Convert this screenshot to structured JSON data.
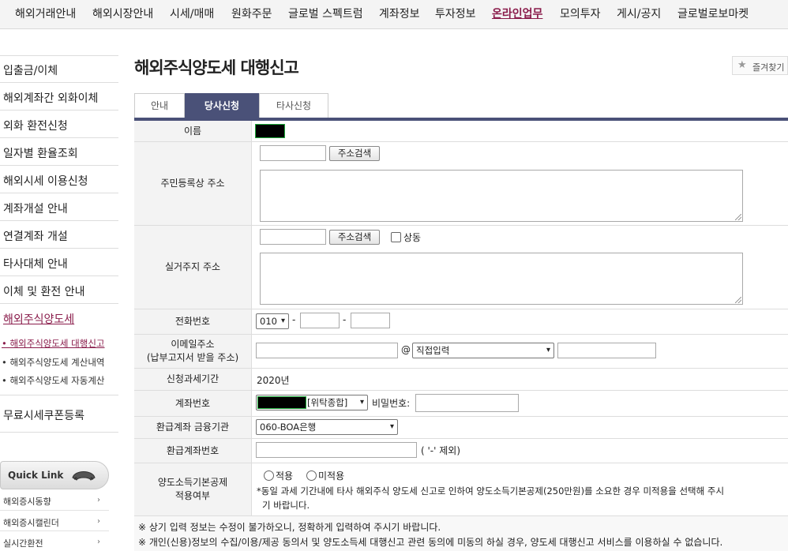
{
  "topnav": {
    "items": [
      "해외거래안내",
      "해외시장안내",
      "시세/매매",
      "원화주문",
      "글로벌 스펙트럼",
      "계좌정보",
      "투자정보",
      "온라인업무",
      "모의투자",
      "게시/공지",
      "글로벌로보마켓"
    ]
  },
  "sidebar": {
    "items": [
      "입출금/이체",
      "해외계좌간 외화이체",
      "외화 환전신청",
      "일자별 환율조회",
      "해외시세 이용신청",
      "계좌개설 안내",
      "연결계좌 개설",
      "타사대체 안내",
      "이체 및 환전 안내",
      "해외주식양도세"
    ],
    "subitems": [
      "해외주식양도세 대행신고",
      "해외주식양도세 계산내역",
      "해외주식양도세 자동계산"
    ],
    "extra": "무료시세쿠폰등록",
    "quick_link": "Quick Link",
    "quick_links": [
      "해외증시동향",
      "해외증시캘린더",
      "실시간환전"
    ]
  },
  "page": {
    "title": "해외주식양도세 대행신고",
    "bookmark": "즐겨찾기"
  },
  "tabs": [
    "안내",
    "당사신청",
    "타사신청"
  ],
  "form": {
    "name_label": "이름",
    "address_label": "주민등록상 주소",
    "address_search": "주소검색",
    "real_address_label": "실거주지 주소",
    "real_address_search": "주소검색",
    "same_label": "상동",
    "phone_label": "전화번호",
    "phone_prefix": "010",
    "phone_dash1": "-",
    "phone_dash2": "-",
    "email_label_1": "이메일주소",
    "email_label_2": "(납부고지서 받을 주소)",
    "email_at": "@",
    "email_domain": "직접입력",
    "period_label": "신청과세기간",
    "period_value": "2020년",
    "account_label": "계좌번호",
    "account_type": "[위탁종합]",
    "password_label": "비밀번호:",
    "refund_bank_label": "환급계좌 금융기관",
    "refund_bank_value": "060-BOA은행",
    "refund_account_label": "환급계좌번호",
    "refund_account_hint": "( '-' 제외)",
    "deduction_label_1": "양도소득기본공제",
    "deduction_label_2": "적용여부",
    "radio_apply": "적용",
    "radio_not_apply": "미적용",
    "deduction_note_1": "*동일 과세 기간내에 타사 해외주식 양도세 신고로 인하여 양도소득기본공제(250만원)를 소요한 경우 미적용을 선택해 주시",
    "deduction_note_2": "기 바랍니다."
  },
  "notes": [
    "※ 상기 입력 정보는 수정이 불가하오니, 정확하게 입력하여 주시기 바랍니다.",
    "※ 개인(신용)정보의 수집/이용/제공 동의서 및 양도소득세 대행신고 관련 동의에 미동의 하실 경우, 양도세 대행신고 서비스를 이용하실 수 없습니다."
  ]
}
